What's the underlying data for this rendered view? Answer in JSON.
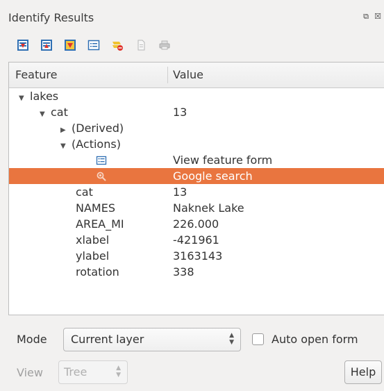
{
  "panel": {
    "title": "Identify Results",
    "float_glyph": "⧉",
    "close_glyph": "☒"
  },
  "toolbar": {
    "buttons": [
      {
        "name": "expand-tree-icon"
      },
      {
        "name": "collapse-tree-icon"
      },
      {
        "name": "expand-new-results-icon"
      },
      {
        "name": "open-form-icon"
      },
      {
        "name": "clear-results-icon"
      },
      {
        "name": "copy-icon"
      },
      {
        "name": "print-icon"
      }
    ]
  },
  "tree": {
    "columns": {
      "feature": "Feature",
      "value": "Value"
    },
    "rows": [
      {
        "feature": "lakes",
        "value": ""
      },
      {
        "feature": "cat",
        "value": "13"
      },
      {
        "feature": "(Derived)",
        "value": ""
      },
      {
        "feature": "(Actions)",
        "value": ""
      },
      {
        "feature": "",
        "value": "View feature form"
      },
      {
        "feature": "",
        "value": "Google search"
      },
      {
        "feature": "cat",
        "value": "13"
      },
      {
        "feature": "NAMES",
        "value": "Naknek Lake"
      },
      {
        "feature": "AREA_MI",
        "value": "226.000"
      },
      {
        "feature": "xlabel",
        "value": "-421961"
      },
      {
        "feature": "ylabel",
        "value": "3163143"
      },
      {
        "feature": "rotation",
        "value": "338"
      }
    ],
    "selected_row": "Google search",
    "selection_color": "#e9753f"
  },
  "mode": {
    "label": "Mode",
    "selected": "Current layer",
    "auto_open_label": "Auto open form",
    "auto_open_checked": false
  },
  "view": {
    "label": "View",
    "selected": "Tree",
    "enabled": false
  },
  "help_label": "Help",
  "glyphs": {
    "expanded": "▼",
    "collapsed": "▶",
    "up": "▲",
    "down": "▼"
  }
}
